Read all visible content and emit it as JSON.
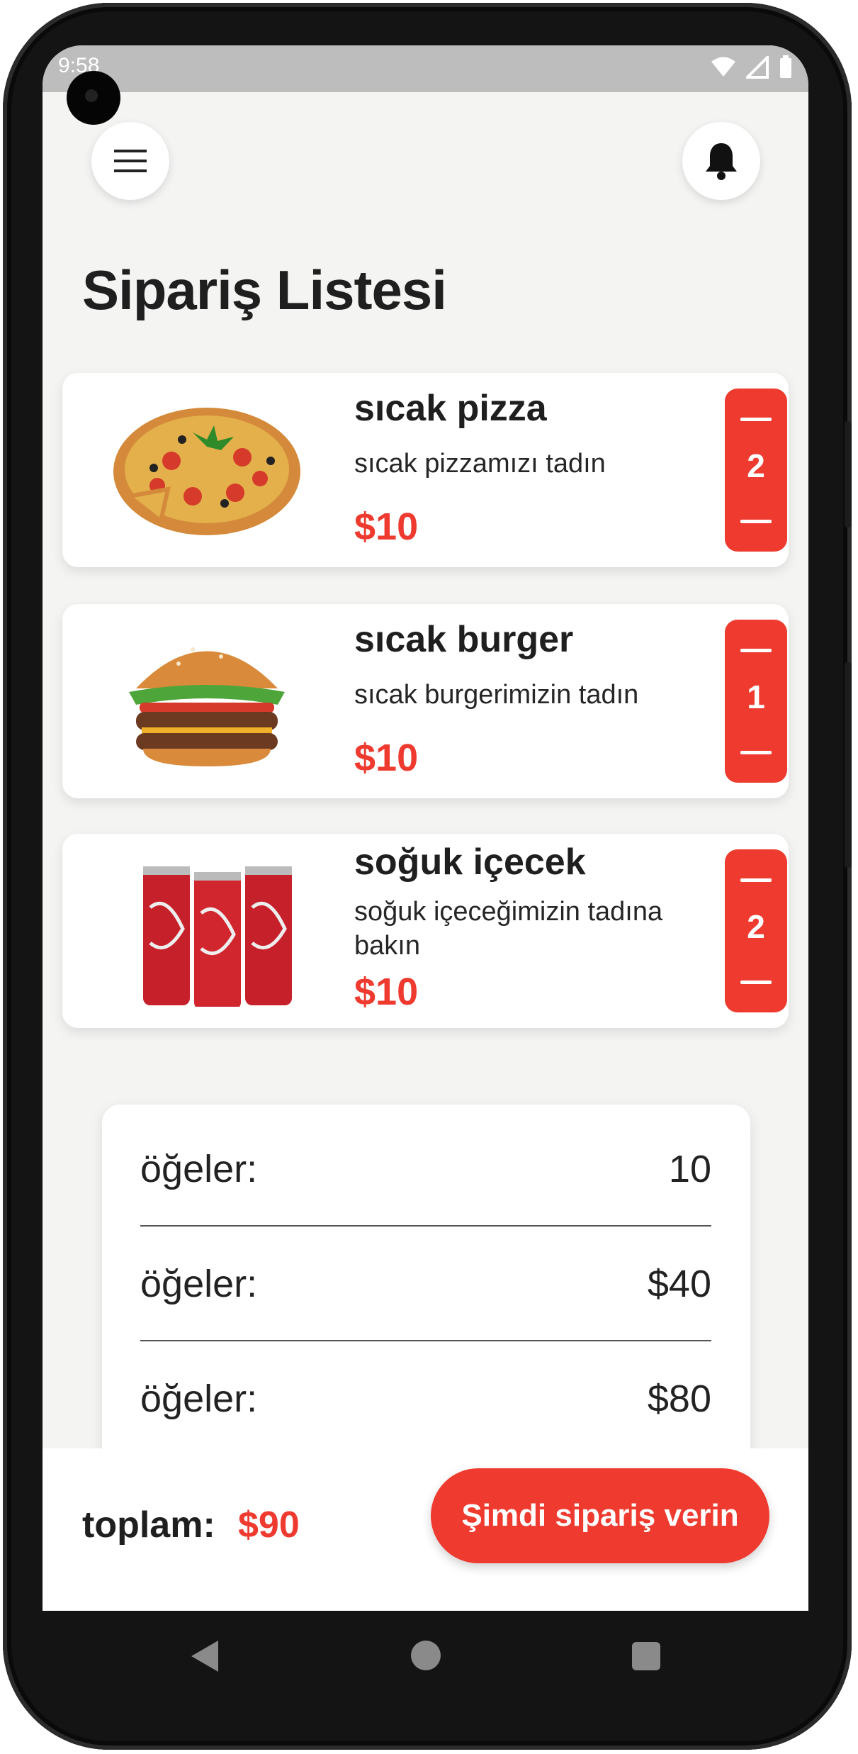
{
  "status_bar": {
    "time": "9:58"
  },
  "header": {
    "menu_icon": "hamburger-menu-icon",
    "notification_icon": "bell-icon"
  },
  "page": {
    "title": "Sipariş Listesi"
  },
  "orders": [
    {
      "name": "sıcak pizza",
      "description": "sıcak pizzamızı tadın",
      "price": "$10",
      "quantity": "2",
      "image": "pizza-image"
    },
    {
      "name": "sıcak burger",
      "description": "sıcak burgerimizin tadın",
      "price": "$10",
      "quantity": "1",
      "image": "burger-image"
    },
    {
      "name": "soğuk içecek",
      "description": "soğuk içeceğimizin tadına bakın",
      "price": "$10",
      "quantity": "2",
      "image": "drink-cans-image"
    }
  ],
  "summary": {
    "rows": [
      {
        "label": "öğeler:",
        "value": "10"
      },
      {
        "label": "öğeler:",
        "value": "$40"
      },
      {
        "label": "öğeler:",
        "value": "$80"
      }
    ]
  },
  "footer": {
    "total_label": "toplam:",
    "total_value": "$90",
    "order_button": "Şimdi sipariş verin"
  },
  "colors": {
    "accent": "#ef3a2f",
    "background": "#f4f4f3",
    "card": "#ffffff"
  }
}
